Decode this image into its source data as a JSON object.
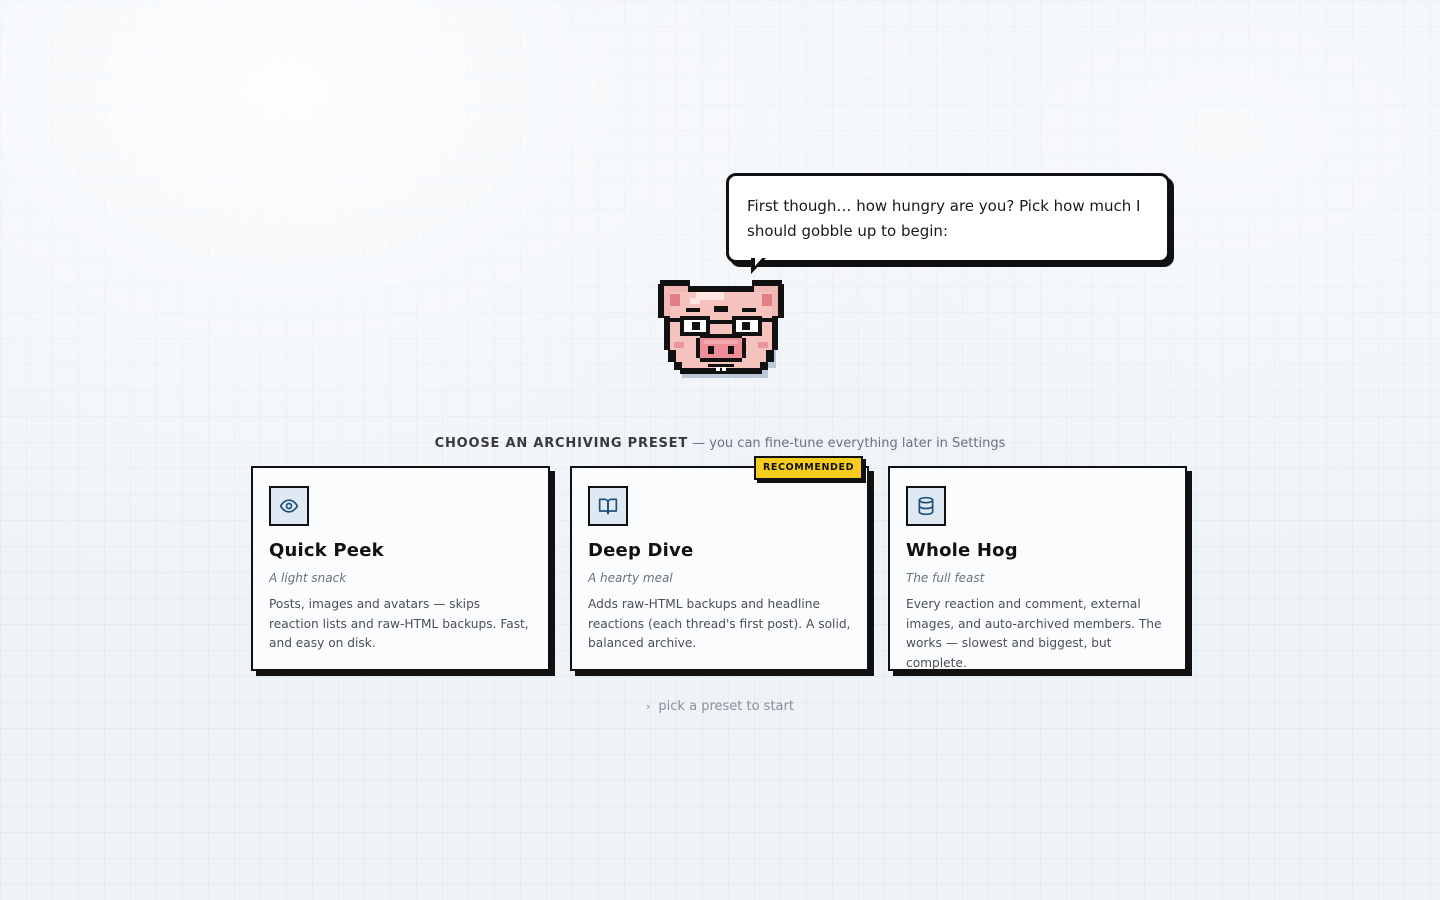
{
  "mascot": {
    "speech": "First though… how hungry are you? Pick how much I should gobble up to begin:",
    "icon": "pig-mascot-icon"
  },
  "presets": {
    "heading": "CHOOSE AN ARCHIVING PRESET",
    "subheading": "— you can fine-tune everything later in Settings",
    "badge": "RECOMMENDED",
    "items": [
      {
        "title": "Quick Peek",
        "subtitle": "A light snack",
        "description": "Posts, images and avatars — skips reaction lists and raw-HTML backups. Fast, and easy on disk.",
        "icon": "eye-icon"
      },
      {
        "title": "Deep Dive",
        "subtitle": "A hearty meal",
        "description": "Adds raw-HTML backups and headline reactions (each thread's first post). A solid, balanced archive.",
        "icon": "book-open-icon"
      },
      {
        "title": "Whole Hog",
        "subtitle": "The full feast",
        "description": "Every reaction and comment, external images, and auto-archived members. The works — slowest and biggest, but complete.",
        "icon": "database-icon"
      }
    ]
  },
  "hint": {
    "text": "pick a preset to start",
    "icon": "chevron-right-icon"
  },
  "colors": {
    "background": "#eef3f8",
    "badge": "#f6cd1c",
    "icon_box": "#dfe9f3",
    "icon_stroke": "#1f4e79",
    "border": "#111111"
  }
}
